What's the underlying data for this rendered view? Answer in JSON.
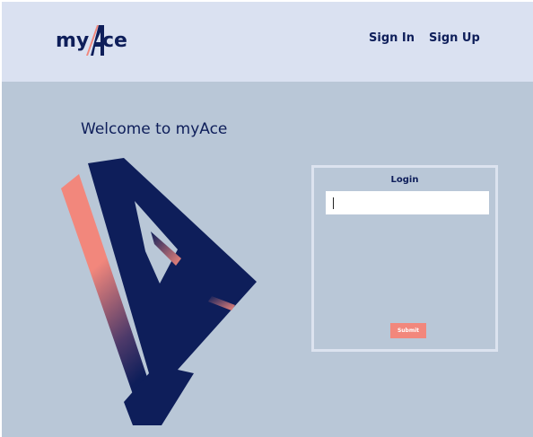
{
  "header": {
    "logo": {
      "text_my": "my",
      "text_ace": "ce",
      "full": "myAce"
    },
    "nav": {
      "sign_in": "Sign In",
      "sign_up": "Sign Up"
    }
  },
  "main": {
    "welcome": "Welcome to myAce"
  },
  "login": {
    "title": "Login",
    "input_value": "",
    "submit_label": "Submit"
  },
  "colors": {
    "header_bg": "#dae1f1",
    "page_bg": "#b9c7d7",
    "navy": "#0e1e5a",
    "coral": "#f2877c",
    "panel_border": "#dce3ef"
  },
  "icons": {
    "logo": "myace-logo",
    "hero": "large-a-letter-logo"
  }
}
